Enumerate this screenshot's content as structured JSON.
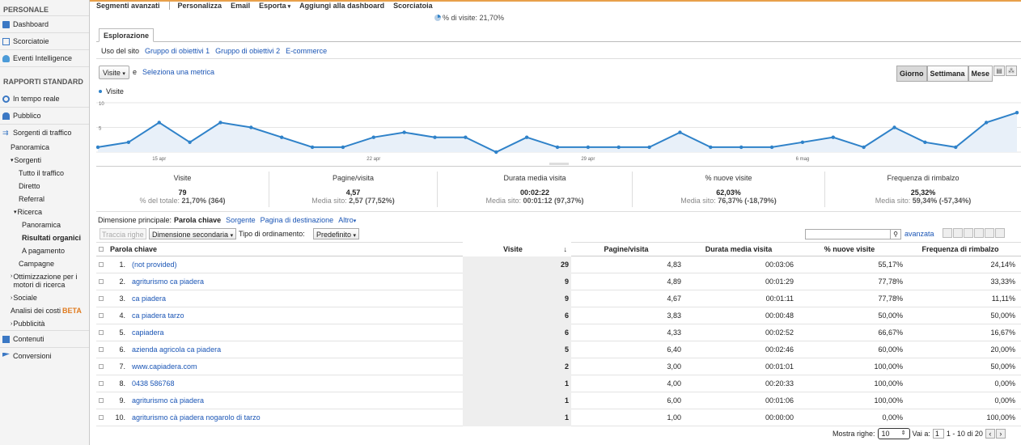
{
  "sidebar": {
    "personal_header": "PERSONALE",
    "personal": [
      "Dashboard",
      "Scorciatoie",
      "Eventi Intelligence"
    ],
    "standard_header": "RAPPORTI STANDARD",
    "realtime": "In tempo reale",
    "audience": "Pubblico",
    "traffic": "Sorgenti di traffico",
    "traffic_sub": {
      "overview": "Panoramica",
      "sources": "Sorgenti",
      "all": "Tutto il traffico",
      "direct": "Diretto",
      "referral": "Referral",
      "search": "Ricerca",
      "search_overview": "Panoramica",
      "organic": "Risultati organici",
      "paid": "A pagamento",
      "campaigns": "Campagne",
      "seo": "Ottimizzazione per i motori di ricerca",
      "social": "Sociale",
      "cost": "Analisi dei costi",
      "beta": "BETA",
      "advertising": "Pubblicità"
    },
    "content": "Contenuti",
    "conversions": "Conversioni"
  },
  "menubar": [
    "Segmenti avanzati",
    "Personalizza",
    "Email",
    "Esporta",
    "Aggiungi alla dashboard",
    "Scorciatoia"
  ],
  "visits_pct": "% di visite: 21,70%",
  "tab": "Esplorazione",
  "subtabs": [
    "Uso del sito",
    "Gruppo di obiettivi 1",
    "Gruppo di obiettivi 2",
    "E-commerce"
  ],
  "metric_select": "Visite",
  "and_label": "e",
  "select_metric": "Seleziona una metrica",
  "period": [
    "Giorno",
    "Settimana",
    "Mese"
  ],
  "chart_data": {
    "type": "area",
    "series": [
      {
        "name": "Visite",
        "values": [
          1,
          2,
          6,
          2,
          6,
          5,
          3,
          1,
          1,
          3,
          4,
          3,
          3,
          0,
          3,
          1,
          1,
          1,
          1,
          4,
          1,
          1,
          1,
          2,
          3,
          1,
          5,
          2,
          1,
          6,
          8
        ]
      }
    ],
    "y_ticks": [
      "10",
      "5"
    ],
    "ylim": [
      0,
      10
    ],
    "x_ticks": [
      {
        "label": "15 apr",
        "index": 2
      },
      {
        "label": "22 apr",
        "index": 9
      },
      {
        "label": "29 apr",
        "index": 16
      },
      {
        "label": "6 mag",
        "index": 23
      }
    ],
    "color": "#2f82c9"
  },
  "summary": [
    {
      "label": "Visite",
      "value": "79",
      "sub_prefix": "% del totale:",
      "sub_bold": "21,70% (364)"
    },
    {
      "label": "Pagine/visita",
      "value": "4,57",
      "sub_prefix": "Media sito:",
      "sub_bold": "2,57 (77,52%)"
    },
    {
      "label": "Durata media visita",
      "value": "00:02:22",
      "sub_prefix": "Media sito:",
      "sub_bold": "00:01:12 (97,37%)"
    },
    {
      "label": "% nuove visite",
      "value": "62,03%",
      "sub_prefix": "Media sito:",
      "sub_bold": "76,37% (-18,79%)"
    },
    {
      "label": "Frequenza di rimbalzo",
      "value": "25,32%",
      "sub_prefix": "Media sito:",
      "sub_bold": "59,34% (-57,34%)"
    }
  ],
  "dimension": {
    "label": "Dimensione principale:",
    "current": "Parola chiave",
    "others": [
      "Sorgente",
      "Pagina di destinazione",
      "Altro"
    ]
  },
  "controls": {
    "plot_rows": "Traccia righe",
    "secondary": "Dimensione secondaria",
    "sort_label": "Tipo di ordinamento:",
    "sort_value": "Predefinito",
    "advanced": "avanzata"
  },
  "table": {
    "headers": [
      "Parola chiave",
      "Visite",
      "Pagine/visita",
      "Durata media visita",
      "% nuove visite",
      "Frequenza di rimbalzo"
    ],
    "sort_arrow": "↓",
    "rows": [
      {
        "n": "1.",
        "kw": "(not provided)",
        "v": "29",
        "p": "4,83",
        "d": "00:03:06",
        "nv": "55,17%",
        "r": "24,14%"
      },
      {
        "n": "2.",
        "kw": "agriturismo ca piadera",
        "v": "9",
        "p": "4,89",
        "d": "00:01:29",
        "nv": "77,78%",
        "r": "33,33%"
      },
      {
        "n": "3.",
        "kw": "ca piadera",
        "v": "9",
        "p": "4,67",
        "d": "00:01:11",
        "nv": "77,78%",
        "r": "11,11%"
      },
      {
        "n": "4.",
        "kw": "ca piadera tarzo",
        "v": "6",
        "p": "3,83",
        "d": "00:00:48",
        "nv": "50,00%",
        "r": "50,00%"
      },
      {
        "n": "5.",
        "kw": "capiadera",
        "v": "6",
        "p": "4,33",
        "d": "00:02:52",
        "nv": "66,67%",
        "r": "16,67%"
      },
      {
        "n": "6.",
        "kw": "azienda agricola ca piadera",
        "v": "5",
        "p": "6,40",
        "d": "00:02:46",
        "nv": "60,00%",
        "r": "20,00%"
      },
      {
        "n": "7.",
        "kw": "www.capiadera.com",
        "v": "2",
        "p": "3,00",
        "d": "00:01:01",
        "nv": "100,00%",
        "r": "50,00%"
      },
      {
        "n": "8.",
        "kw": "0438 586768",
        "v": "1",
        "p": "4,00",
        "d": "00:20:33",
        "nv": "100,00%",
        "r": "0,00%"
      },
      {
        "n": "9.",
        "kw": "agriturismo cà piadera",
        "v": "1",
        "p": "6,00",
        "d": "00:01:06",
        "nv": "100,00%",
        "r": "0,00%"
      },
      {
        "n": "10.",
        "kw": "agriturismo cà piadera nogarolo di tarzo",
        "v": "1",
        "p": "1,00",
        "d": "00:00:00",
        "nv": "0,00%",
        "r": "100,00%"
      }
    ]
  },
  "pager": {
    "show_rows": "Mostra righe:",
    "rows_value": "10",
    "goto": "Vai a:",
    "goto_value": "1",
    "range": "1 - 10 di 20"
  }
}
